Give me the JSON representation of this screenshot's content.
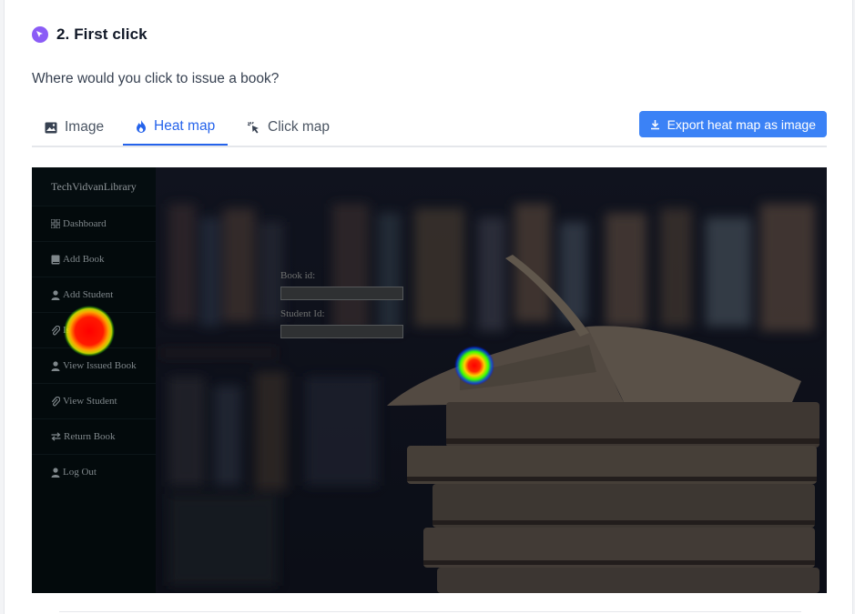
{
  "question": {
    "number_title": "2. First click",
    "prompt": "Where would you click to issue a book?"
  },
  "tabs": [
    {
      "label": "Image",
      "icon": "image-icon",
      "active": false
    },
    {
      "label": "Heat map",
      "icon": "flame-icon",
      "active": true
    },
    {
      "label": "Click map",
      "icon": "pointer-click-icon",
      "active": false
    }
  ],
  "export_button": {
    "label": "Export heat map as image",
    "icon": "download-icon"
  },
  "screenshot": {
    "brand": "TechVidvanLibrary",
    "nav": [
      {
        "label": "Dashboard",
        "icon": "grid-icon"
      },
      {
        "label": "Add Book",
        "icon": "book-icon"
      },
      {
        "label": "Add Student",
        "icon": "user-icon"
      },
      {
        "label": "Issue Book",
        "icon": "paperclip-icon"
      },
      {
        "label": "View Issued Book",
        "icon": "user-icon"
      },
      {
        "label": "View Student",
        "icon": "paperclip-icon"
      },
      {
        "label": "Return Book",
        "icon": "exchange-icon"
      },
      {
        "label": "Log Out",
        "icon": "user-icon"
      }
    ],
    "form": {
      "book_id_label": "Book id:",
      "student_id_label": "Student Id:"
    }
  },
  "colors": {
    "accent": "#2563eb",
    "button": "#3b82f6",
    "badge": "#8b5cf6"
  }
}
